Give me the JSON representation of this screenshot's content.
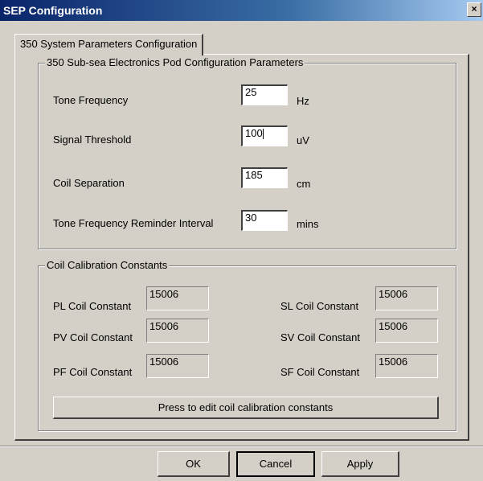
{
  "window": {
    "title": "SEP Configuration",
    "close_glyph": "×"
  },
  "tab": {
    "label": "350 System Parameters Configuration"
  },
  "pod_group": {
    "title": "350 Sub-sea Electronics Pod Configuration Parameters",
    "fields": [
      {
        "label": "Tone Frequency",
        "value": "25",
        "unit": "Hz"
      },
      {
        "label": "Signal Threshold",
        "value": "100",
        "unit": "uV"
      },
      {
        "label": "Coil Separation",
        "value": "185",
        "unit": "cm"
      },
      {
        "label": "Tone Frequency Reminder Interval",
        "value": "30",
        "unit": "mins"
      }
    ]
  },
  "coil_group": {
    "title": "Coil Calibration Constants",
    "left": [
      {
        "label": "PL Coil Constant",
        "value": "15006"
      },
      {
        "label": "PV Coil Constant",
        "value": "15006"
      },
      {
        "label": "PF Coil Constant",
        "value": "15006"
      }
    ],
    "right": [
      {
        "label": "SL Coil Constant",
        "value": "15006"
      },
      {
        "label": "SV Coil Constant",
        "value": "15006"
      },
      {
        "label": "SF Coil Constant",
        "value": "15006"
      }
    ],
    "edit_button": "Press to edit coil calibration constants"
  },
  "footer": {
    "ok": "OK",
    "cancel": "Cancel",
    "apply": "Apply"
  }
}
